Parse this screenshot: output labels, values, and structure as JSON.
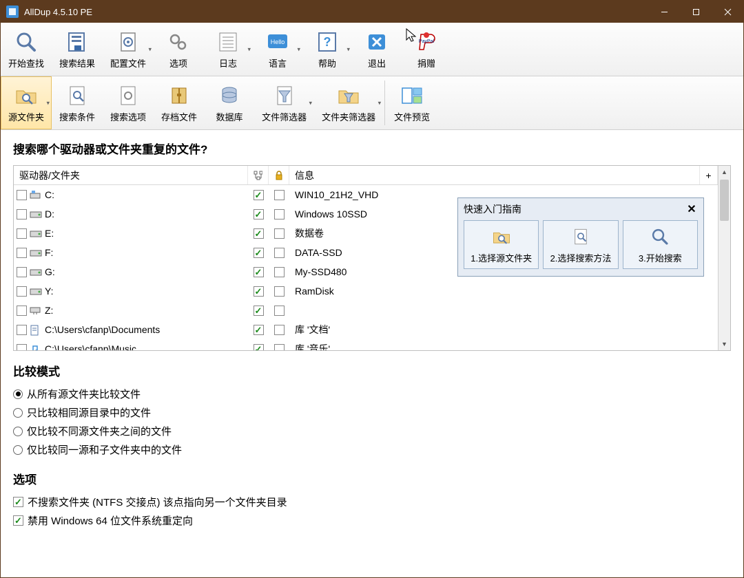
{
  "window": {
    "title": "AllDup 4.5.10 PE"
  },
  "toolbar1": {
    "items": [
      {
        "label": "开始查找",
        "name": "start-search-button",
        "icon": "magnifier"
      },
      {
        "label": "搜索结果",
        "name": "search-results-button",
        "icon": "results"
      },
      {
        "label": "配置文件",
        "name": "profile-button",
        "icon": "gear-doc",
        "dropdown": true
      },
      {
        "label": "选项",
        "name": "options-button",
        "icon": "gears"
      },
      {
        "label": "日志",
        "name": "log-button",
        "icon": "list",
        "dropdown": true
      },
      {
        "label": "语言",
        "name": "language-button",
        "icon": "hello",
        "dropdown": true
      },
      {
        "label": "帮助",
        "name": "help-button",
        "icon": "question",
        "dropdown": true
      },
      {
        "label": "退出",
        "name": "exit-button",
        "icon": "close-blue"
      },
      {
        "label": "捐赠",
        "name": "donate-button",
        "icon": "paypal"
      }
    ]
  },
  "toolbar2": {
    "items": [
      {
        "label": "源文件夹",
        "name": "source-folder-tab",
        "icon": "folder-mag",
        "active": true,
        "dropdown": true
      },
      {
        "label": "搜索条件",
        "name": "search-criteria-tab",
        "icon": "doc-mag"
      },
      {
        "label": "搜索选项",
        "name": "search-options-tab",
        "icon": "doc-gear"
      },
      {
        "label": "存档文件",
        "name": "archive-tab",
        "icon": "archive"
      },
      {
        "label": "数据库",
        "name": "database-tab",
        "icon": "db"
      },
      {
        "label": "文件筛选器",
        "name": "file-filter-tab",
        "icon": "filter",
        "dropdown": true
      },
      {
        "label": "文件夹筛选器",
        "name": "folder-filter-tab",
        "icon": "folder-filter",
        "dropdown": true
      },
      {
        "label": "文件预览",
        "name": "file-preview-tab",
        "icon": "preview",
        "sep_before": true
      }
    ]
  },
  "main": {
    "heading": "搜索哪个驱动器或文件夹重复的文件?",
    "columns": {
      "path": "驱动器/文件夹",
      "col1_icon": "tree-icon",
      "col2_icon": "lock-icon",
      "info": "信息"
    },
    "rows": [
      {
        "sel": false,
        "icon": "drive-sys",
        "path": "C:",
        "c1": true,
        "c2": false,
        "info": "WIN10_21H2_VHD"
      },
      {
        "sel": false,
        "icon": "drive",
        "path": "D:",
        "c1": true,
        "c2": false,
        "info": "Windows 10SSD"
      },
      {
        "sel": false,
        "icon": "drive",
        "path": "E:",
        "c1": true,
        "c2": false,
        "info": "数据卷"
      },
      {
        "sel": false,
        "icon": "drive",
        "path": "F:",
        "c1": true,
        "c2": false,
        "info": "DATA-SSD"
      },
      {
        "sel": false,
        "icon": "drive",
        "path": "G:",
        "c1": true,
        "c2": false,
        "info": "My-SSD480"
      },
      {
        "sel": false,
        "icon": "drive",
        "path": "Y:",
        "c1": true,
        "c2": false,
        "info": "RamDisk"
      },
      {
        "sel": false,
        "icon": "drive-net",
        "path": "Z:",
        "c1": true,
        "c2": false,
        "info": ""
      },
      {
        "sel": false,
        "icon": "doc",
        "path": "C:\\Users\\cfanp\\Documents",
        "c1": true,
        "c2": false,
        "info": "库 '文档'"
      },
      {
        "sel": false,
        "icon": "music",
        "path": "C:\\Users\\cfanp\\Music",
        "c1": true,
        "c2": false,
        "info": "库 '音乐'"
      }
    ]
  },
  "quick_guide": {
    "title": "快速入门指南",
    "items": [
      {
        "label": "1.选择源文件夹",
        "name": "guide-step-1"
      },
      {
        "label": "2.选择搜索方法",
        "name": "guide-step-2"
      },
      {
        "label": "3.开始搜索",
        "name": "guide-step-3"
      }
    ]
  },
  "compare": {
    "legend": "比较模式",
    "options": [
      {
        "label": "从所有源文件夹比较文件",
        "checked": true
      },
      {
        "label": "只比较相同源目录中的文件",
        "checked": false
      },
      {
        "label": "仅比较不同源文件夹之间的文件",
        "checked": false
      },
      {
        "label": "仅比较同一源和子文件夹中的文件",
        "checked": false
      }
    ]
  },
  "options": {
    "legend": "选项",
    "items": [
      {
        "label": "不搜索文件夹 (NTFS 交接点) 该点指向另一个文件夹目录",
        "checked": true
      },
      {
        "label": "禁用 Windows 64 位文件系统重定向",
        "checked": true
      }
    ]
  }
}
